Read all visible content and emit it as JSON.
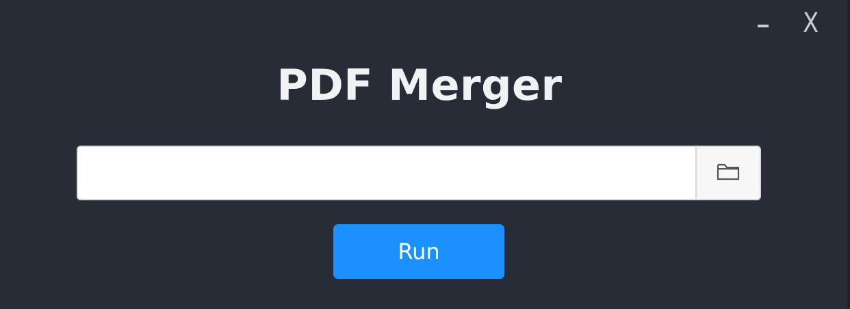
{
  "window": {
    "minimize_label": "-",
    "close_label": "X"
  },
  "app": {
    "title": "PDF Merger"
  },
  "file_input": {
    "value": "",
    "placeholder": "",
    "browse_icon": "folder-icon"
  },
  "actions": {
    "run_label": "Run"
  },
  "colors": {
    "background": "#272c36",
    "title_text": "#f1f2f4",
    "run_button": "#1b90ff",
    "input_border": "#d9d9d9"
  }
}
